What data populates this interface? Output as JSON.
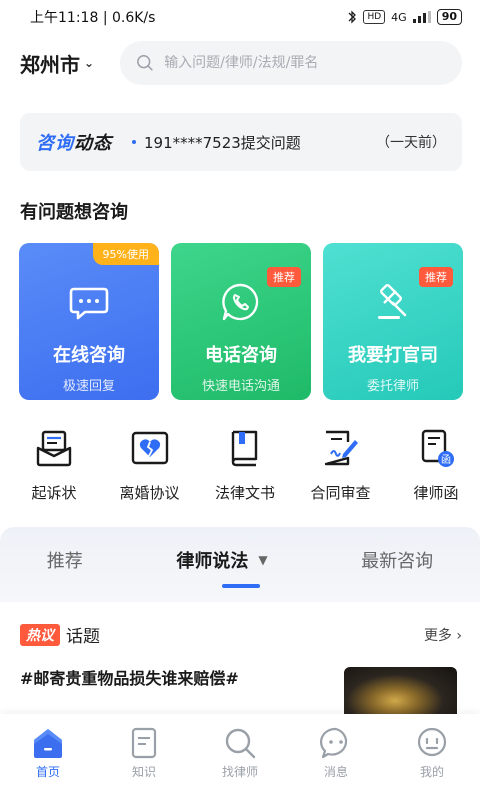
{
  "status_bar": {
    "time": "上午11:18",
    "speed": "0.6K/s",
    "hd": "HD",
    "network": "4G",
    "battery": "90"
  },
  "header": {
    "city": "郑州市",
    "search_placeholder": "输入问题/律师/法规/罪名"
  },
  "dynamic": {
    "logo_part1": "咨询",
    "logo_part2": "动态",
    "text": "191****7523提交问题",
    "time": "（一天前）"
  },
  "section_title": "有问题想咨询",
  "cards": [
    {
      "title": "在线咨询",
      "sub": "极速回复",
      "badge": "95%使用"
    },
    {
      "title": "电话咨询",
      "sub": "快速电话沟通",
      "badge": "推荐"
    },
    {
      "title": "我要打官司",
      "sub": "委托律师",
      "badge": "推荐"
    }
  ],
  "tools": [
    {
      "label": "起诉状",
      "icon": "indictment-icon"
    },
    {
      "label": "离婚协议",
      "icon": "divorce-agreement-icon"
    },
    {
      "label": "法律文书",
      "icon": "legal-document-icon"
    },
    {
      "label": "合同审查",
      "icon": "contract-review-icon"
    },
    {
      "label": "律师函",
      "icon": "lawyer-letter-icon"
    }
  ],
  "tabs": [
    {
      "label": "推荐"
    },
    {
      "label": "律师说法"
    },
    {
      "label": "最新咨询"
    }
  ],
  "topic": {
    "badge": "热议",
    "label": "话题",
    "more": "更多 ›",
    "item": "#邮寄贵重物品损失谁来赔偿#"
  },
  "bottom_nav": [
    {
      "label": "首页",
      "icon": "home-icon"
    },
    {
      "label": "知识",
      "icon": "knowledge-icon"
    },
    {
      "label": "找律师",
      "icon": "find-lawyer-icon"
    },
    {
      "label": "消息",
      "icon": "message-icon"
    },
    {
      "label": "我的",
      "icon": "profile-icon"
    }
  ],
  "colors": {
    "accent": "#2f6df6",
    "card_blue": "#3c6ef0",
    "card_green": "#1fba68",
    "card_teal": "#25c9b8",
    "badge_orange": "#ffb21a",
    "badge_red": "#ff5a3c"
  }
}
